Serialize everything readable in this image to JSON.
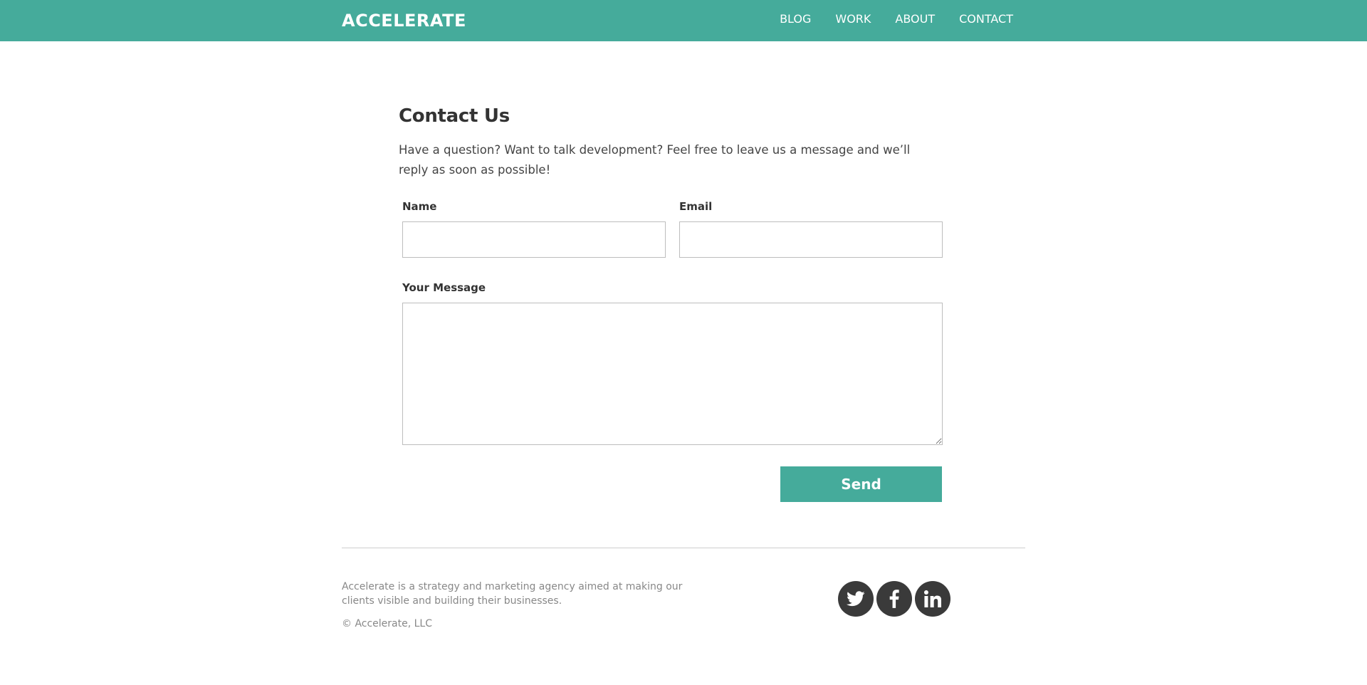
{
  "header": {
    "logo": "ACCELERATE",
    "nav": [
      "BLOG",
      "WORK",
      "ABOUT",
      "CONTACT"
    ]
  },
  "contact": {
    "title": "Contact Us",
    "intro": "Have a question? Want to talk development? Feel free to leave us a message and we’ll reply as soon as possible!",
    "name_label": "Name",
    "name_value": "",
    "email_label": "Email",
    "email_value": "",
    "message_label": "Your Message",
    "message_value": "",
    "send_label": "Send"
  },
  "footer": {
    "about": "Accelerate is a strategy and marketing agency aimed at making our clients visible and building their businesses.",
    "copyright": "© Accelerate, LLC",
    "social_icons": [
      "twitter-icon",
      "facebook-icon",
      "linkedin-icon"
    ]
  },
  "colors": {
    "accent": "#45ab9b",
    "text": "#333333",
    "muted": "#888888",
    "social_bg": "#3a3a3a"
  }
}
